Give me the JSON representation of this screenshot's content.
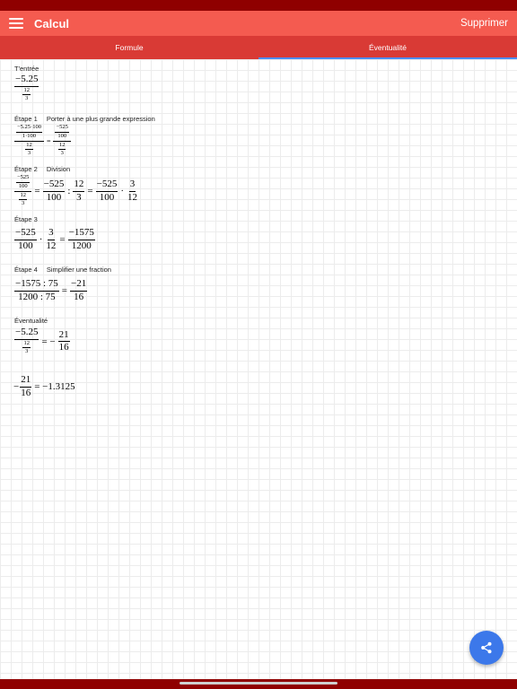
{
  "app": {
    "title": "Calcul",
    "delete_label": "Supprimer",
    "menu_icon": "hamburger-menu-icon",
    "share_icon": "share-icon"
  },
  "tabs": [
    {
      "label": "Formule",
      "active": false
    },
    {
      "label": "Éventualité",
      "active": true
    }
  ],
  "colors": {
    "status_bar": "#8f0000",
    "app_bar": "#f45b50",
    "tab_bar": "#d93a35",
    "tab_indicator": "#4d8cf5",
    "fab": "#3c78ea"
  },
  "input": {
    "label": "T'entrée",
    "outer_num": "−5.25",
    "inner_num": "12",
    "inner_den": "3"
  },
  "step1": {
    "label": "Étape 1",
    "desc": "Porter à une plus grande expression",
    "lhs_top": "−5.25·100",
    "lhs_bot": "1·100",
    "lhs_den_num": "12",
    "lhs_den_den": "3",
    "eq": "=",
    "rhs_top": "−525",
    "rhs_bot": "100",
    "rhs_den_num": "12",
    "rhs_den_den": "3"
  },
  "step2": {
    "label": "Étape 2",
    "desc": "Division",
    "a_top": "−525",
    "a_bot": "100",
    "a_den_num": "12",
    "a_den_den": "3",
    "eq1": "=",
    "b_num": "−525",
    "b_den": "100",
    "colon": ":",
    "c_num": "12",
    "c_den": "3",
    "eq2": "=",
    "d_num": "−525",
    "d_den": "100",
    "dot": "·",
    "e_num": "3",
    "e_den": "12"
  },
  "step3": {
    "label": "Étape 3",
    "a_num": "−525",
    "a_den": "100",
    "dot": "·",
    "b_num": "3",
    "b_den": "12",
    "eq": "=",
    "r_num": "−1575",
    "r_den": "1200"
  },
  "step4": {
    "label": "Étape 4",
    "desc": "Simplifier une fraction",
    "a_num": "−1575 : 75",
    "a_den": "1200 : 75",
    "eq": "=",
    "r_num": "−21",
    "r_den": "16"
  },
  "result": {
    "label": "Éventualité",
    "outer_num": "−5.25",
    "inner_num": "12",
    "inner_den": "3",
    "eq": "= −",
    "r_num": "21",
    "r_den": "16"
  },
  "decimal": {
    "minus": "−",
    "num": "21",
    "den": "16",
    "eq": "= −1.3125"
  }
}
